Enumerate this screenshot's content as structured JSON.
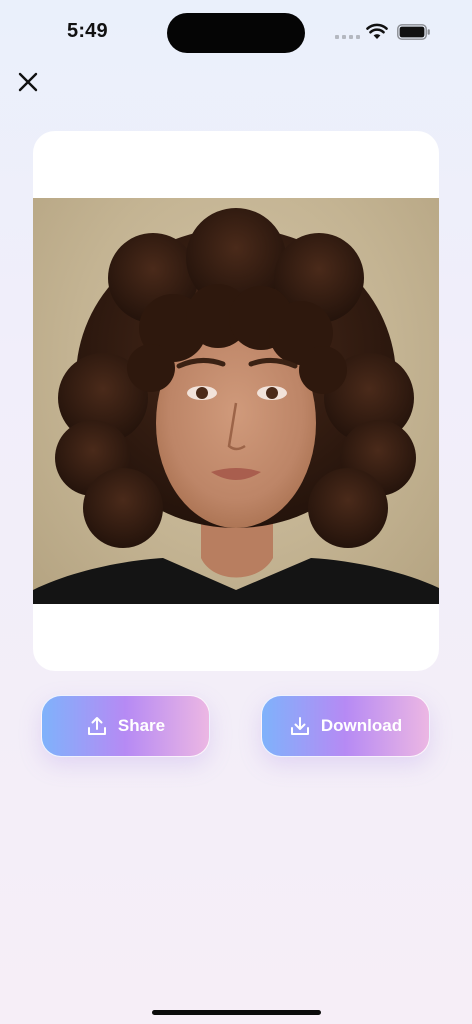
{
  "status_bar": {
    "time": "5:49"
  },
  "header": {
    "close_icon": "close-icon"
  },
  "preview": {
    "image_alt": "Portrait photo of a woman with curly brown hair"
  },
  "actions": {
    "share_label": "Share",
    "share_icon": "upload-icon",
    "download_label": "Download",
    "download_icon": "download-icon"
  },
  "colors": {
    "button_gradient_start": "#7fb2fb",
    "button_gradient_mid": "#b68af4",
    "button_gradient_end": "#ecb7e3"
  }
}
